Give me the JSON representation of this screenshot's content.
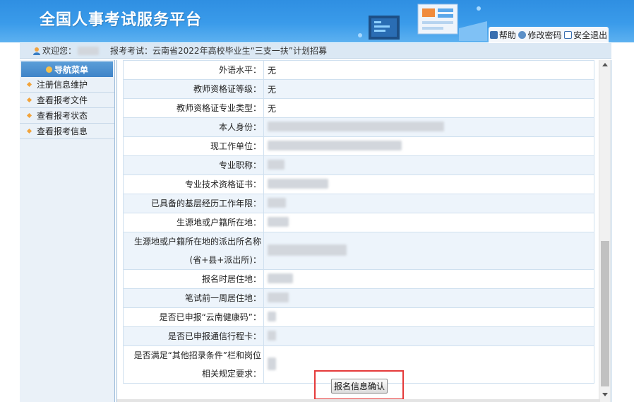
{
  "header": {
    "title": "全国人事考试服务平台",
    "links": [
      {
        "label": "帮助",
        "icon": "help-icon"
      },
      {
        "label": "修改密码",
        "icon": "key-icon"
      },
      {
        "label": "安全退出",
        "icon": "exit-icon"
      }
    ]
  },
  "infobar": {
    "welcome": "欢迎您：",
    "exam_label": "报考考试：",
    "exam_name": "云南省2022年高校毕业生“三支一扶”计划招募"
  },
  "sidebar": {
    "header": "导航菜单",
    "items": [
      {
        "label": "注册信息维护"
      },
      {
        "label": "查看报考文件"
      },
      {
        "label": "查看报考状态"
      },
      {
        "label": "查看报考信息"
      }
    ]
  },
  "form": {
    "rows": [
      {
        "label": "外语水平：",
        "value": "无"
      },
      {
        "label": "教师资格证等级：",
        "value": "无"
      },
      {
        "label": "教师资格证专业类型：",
        "value": "无"
      },
      {
        "label": "本人身份：",
        "value": ""
      },
      {
        "label": "现工作单位：",
        "value": ""
      },
      {
        "label": "专业职称：",
        "value": ""
      },
      {
        "label": "专业技术资格证书：",
        "value": ""
      },
      {
        "label": "已具备的基层经历工作年限：",
        "value": ""
      },
      {
        "label": "生源地或户籍所在地：",
        "value": ""
      },
      {
        "label": "生源地或户籍所在地的派出所名称",
        "label2": "(省+县+派出所)：",
        "value": ""
      },
      {
        "label": "报名时居住地：",
        "value": ""
      },
      {
        "label": "笔试前一周居住地：",
        "value": ""
      },
      {
        "label": "是否已申报“云南健康码”：",
        "value": ""
      },
      {
        "label": "是否已申报通信行程卡：",
        "value": ""
      },
      {
        "label": "是否满足“其他招录条件”栏和岗位",
        "label2": "相关规定要求：",
        "value": ""
      }
    ],
    "confirm_button": "报名信息确认"
  },
  "colors": {
    "header_blue": "#3a9bea",
    "sidebar_bg": "#eaf1f8",
    "highlight_red": "#e53a3a"
  }
}
